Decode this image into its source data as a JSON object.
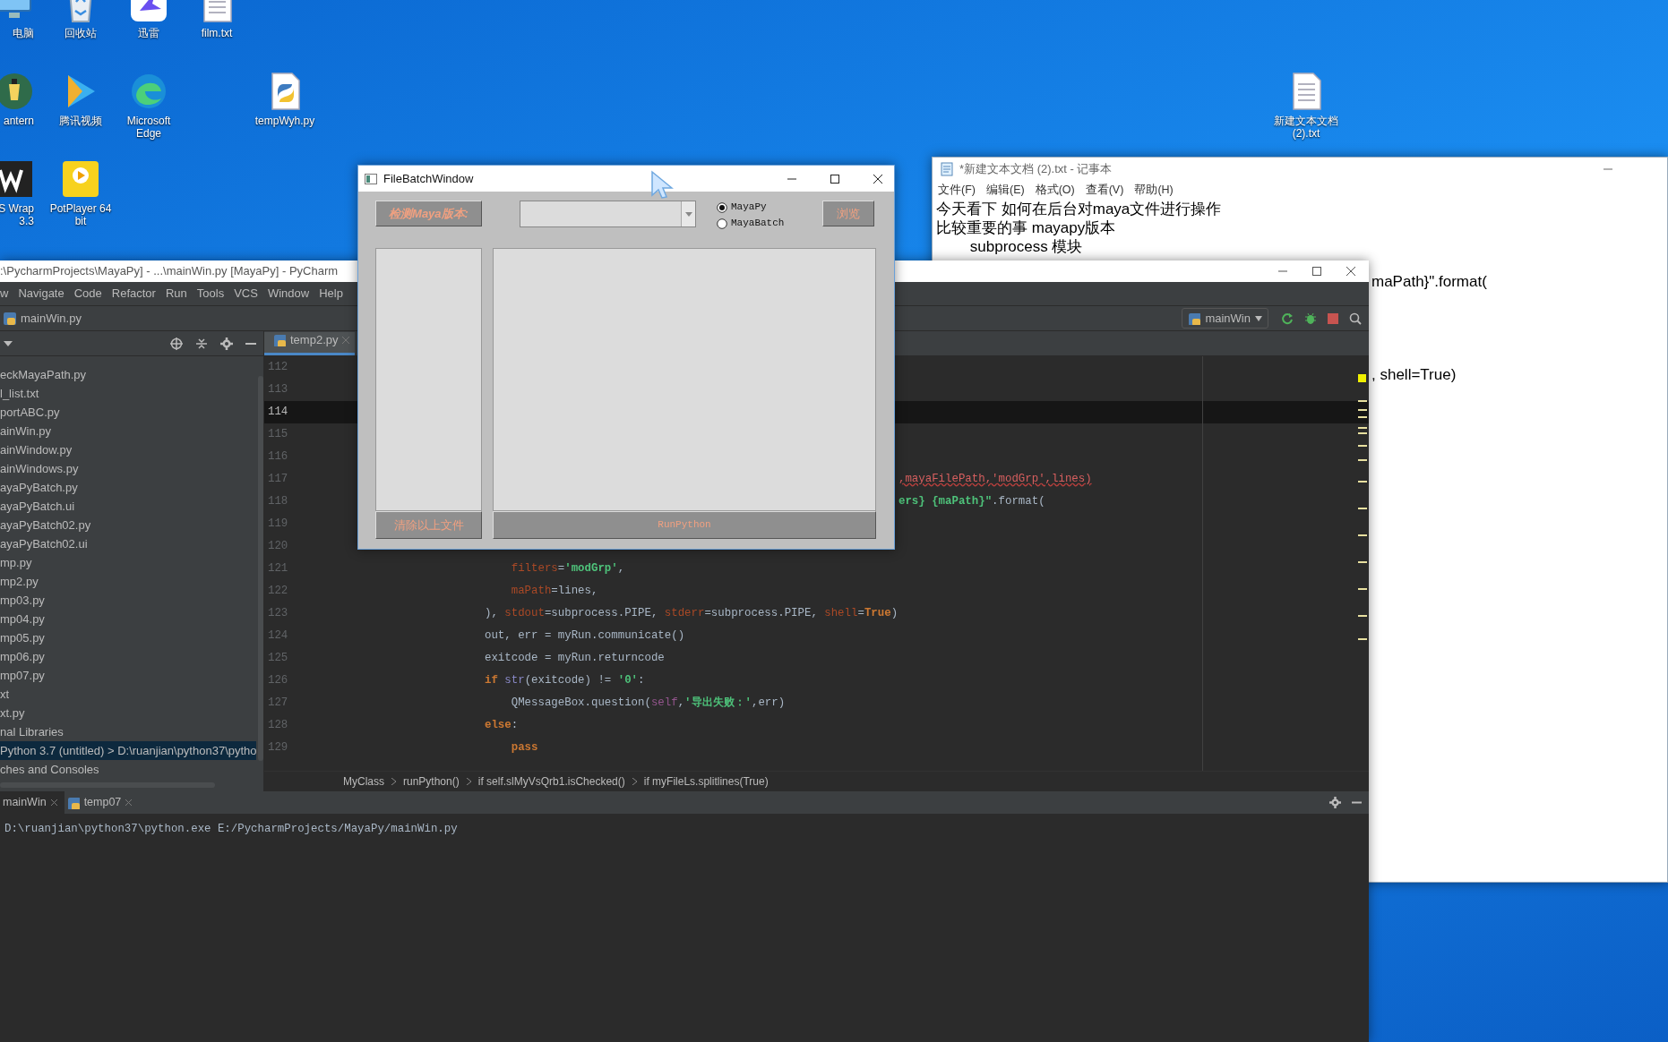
{
  "desktop_icons": [
    {
      "label": "电脑",
      "kind": "computer"
    },
    {
      "label": "回收站",
      "kind": "bin"
    },
    {
      "label": "迅雷",
      "kind": "bird"
    },
    {
      "label": "film.txt",
      "kind": "text"
    },
    {
      "label": "antern",
      "kind": "lantern"
    },
    {
      "label": "腾讯视频",
      "kind": "video"
    },
    {
      "label": "Microsoft Edge",
      "kind": "edge"
    },
    {
      "label": "tempWyh.py",
      "kind": "python"
    },
    {
      "label": "S Wrap 3.3",
      "kind": "wrap"
    },
    {
      "label": "PotPlayer 64 bit",
      "kind": "player"
    }
  ],
  "desktop_icon_right": {
    "label": "新建文本文档 (2).txt",
    "kind": "text"
  },
  "notepad": {
    "title": "*新建文本文档 (2).txt - 记事本",
    "menu": [
      "文件(F)",
      "编辑(E)",
      "格式(O)",
      "查看(V)",
      "帮助(H)"
    ],
    "lines": [
      "今天看下 如何在后台对maya文件进行操作",
      "比较重要的事 mayapy版本",
      "\t\tsubprocess 模块"
    ],
    "partly_hidden_lines": [
      "maPath}\".format(",
      ", shell=True)"
    ]
  },
  "pycharm": {
    "title": ":\\PycharmProjects\\MayaPy] - ...\\mainWin.py [MayaPy] - PyCharm",
    "menu": [
      "w",
      "Navigate",
      "Code",
      "Refactor",
      "Run",
      "Tools",
      "VCS",
      "Window",
      "Help"
    ],
    "nav_file": "mainWin.py",
    "run_config": "mainWin",
    "project_tree": [
      {
        "label": "eckMayaPath.py",
        "selected": false
      },
      {
        "label": "l_list.txt",
        "selected": false
      },
      {
        "label": "portABC.py",
        "selected": false
      },
      {
        "label": "ainWin.py",
        "selected": false
      },
      {
        "label": "ainWindow.py",
        "selected": false
      },
      {
        "label": "ainWindows.py",
        "selected": false
      },
      {
        "label": "ayaPyBatch.py",
        "selected": false
      },
      {
        "label": "ayaPyBatch.ui",
        "selected": false
      },
      {
        "label": "ayaPyBatch02.py",
        "selected": false
      },
      {
        "label": "ayaPyBatch02.ui",
        "selected": false
      },
      {
        "label": "mp.py",
        "selected": false
      },
      {
        "label": "mp2.py",
        "selected": false
      },
      {
        "label": "mp03.py",
        "selected": false
      },
      {
        "label": "mp04.py",
        "selected": false
      },
      {
        "label": "mp05.py",
        "selected": false
      },
      {
        "label": "mp06.py",
        "selected": false
      },
      {
        "label": "mp07.py",
        "selected": false
      },
      {
        "label": "xt",
        "selected": false
      },
      {
        "label": "xt.py",
        "selected": false
      },
      {
        "label": "nal Libraries",
        "selected": false
      },
      {
        "label": "Python 3.7 (untitled) > D:\\ruanjian\\python37\\pytho",
        "selected": true
      },
      {
        "label": "ches and Consoles",
        "selected": false
      }
    ],
    "editor_tab": "temp2.py",
    "code_lines": [
      {
        "number": "112",
        "current": false
      },
      {
        "number": "113",
        "current": false
      },
      {
        "number": "114",
        "current": true
      },
      {
        "number": "115",
        "current": false
      },
      {
        "number": "116",
        "current": false
      },
      {
        "number": "117",
        "kind": "covered",
        "current": false,
        "tokens": [
          {
            "text": ",mayaFilePath,'modGrp',lines)",
            "kind": "error"
          }
        ]
      },
      {
        "number": "118",
        "kind": "covered",
        "current": false,
        "tokens": [
          {
            "text": "ers} {maPath}\"",
            "kind": "string"
          },
          {
            "text": ".format(",
            "kind": "plain"
          }
        ]
      },
      {
        "number": "119",
        "current": false
      },
      {
        "number": "120",
        "current": false
      },
      {
        "number": "121",
        "kind": "code",
        "current": false,
        "tokens": [
          {
            "text": "    filters",
            "kind": "param"
          },
          {
            "text": "=",
            "kind": "plain"
          },
          {
            "text": "'modGrp'",
            "kind": "string"
          },
          {
            "text": ",",
            "kind": "plain"
          }
        ]
      },
      {
        "number": "122",
        "kind": "code",
        "current": false,
        "tokens": [
          {
            "text": "    maPath",
            "kind": "param"
          },
          {
            "text": "=lines,",
            "kind": "plain"
          }
        ]
      },
      {
        "number": "123",
        "kind": "code",
        "current": false,
        "tokens": [
          {
            "text": "), ",
            "kind": "plain"
          },
          {
            "text": "stdout",
            "kind": "param"
          },
          {
            "text": "=subprocess.PIPE, ",
            "kind": "plain"
          },
          {
            "text": "stderr",
            "kind": "param"
          },
          {
            "text": "=subprocess.PIPE, ",
            "kind": "plain"
          },
          {
            "text": "shell",
            "kind": "param"
          },
          {
            "text": "=",
            "kind": "plain"
          },
          {
            "text": "True",
            "kind": "keyword"
          },
          {
            "text": ")",
            "kind": "plain"
          }
        ]
      },
      {
        "number": "124",
        "kind": "code",
        "current": false,
        "tokens": [
          {
            "text": "out, err = myRun.communicate()",
            "kind": "plain"
          }
        ]
      },
      {
        "number": "125",
        "kind": "code",
        "current": false,
        "tokens": [
          {
            "text": "exitcode = myRun.returncode",
            "kind": "plain"
          }
        ]
      },
      {
        "number": "126",
        "kind": "code",
        "current": false,
        "tokens": [
          {
            "text": "if ",
            "kind": "keyword"
          },
          {
            "text": "str",
            "kind": "builtin"
          },
          {
            "text": "(exitcode) != ",
            "kind": "plain"
          },
          {
            "text": "'0'",
            "kind": "string"
          },
          {
            "text": ":",
            "kind": "plain"
          }
        ]
      },
      {
        "number": "127",
        "kind": "code",
        "current": false,
        "tokens": [
          {
            "text": "    QMessageBox.question(",
            "kind": "plain"
          },
          {
            "text": "self",
            "kind": "self"
          },
          {
            "text": ",",
            "kind": "plain"
          },
          {
            "text": "'导出失败：'",
            "kind": "string"
          },
          {
            "text": ",err)",
            "kind": "plain"
          }
        ]
      },
      {
        "number": "128",
        "kind": "code",
        "current": false,
        "tokens": [
          {
            "text": "else",
            "kind": "keyword"
          },
          {
            "text": ":",
            "kind": "plain"
          }
        ]
      },
      {
        "number": "129",
        "kind": "code",
        "current": false,
        "tokens": [
          {
            "text": "    pass",
            "kind": "keyword"
          }
        ]
      }
    ],
    "breadcrumb": [
      "MyClass",
      "runPython()",
      "if self.slMyVsQrb1.isChecked()",
      "if myFileLs.splitlines(True)"
    ],
    "run_tabs": [
      {
        "label": "mainWin",
        "selected": true
      },
      {
        "label": "temp07",
        "selected": false
      }
    ],
    "console": [
      "D:\\ruanjian\\python37\\python.exe E:/PycharmProjects/MayaPy/mainWin.py"
    ]
  },
  "file_batch_window": {
    "title": "FileBatchWindow",
    "detect_button": "检测Maya版本:",
    "radios": [
      {
        "label": "MayaPy",
        "selected": true
      },
      {
        "label": "MayaBatch",
        "selected": false
      }
    ],
    "browse_button": "浏览",
    "clear_button": "清除以上文件",
    "run_button": "RunPython"
  }
}
